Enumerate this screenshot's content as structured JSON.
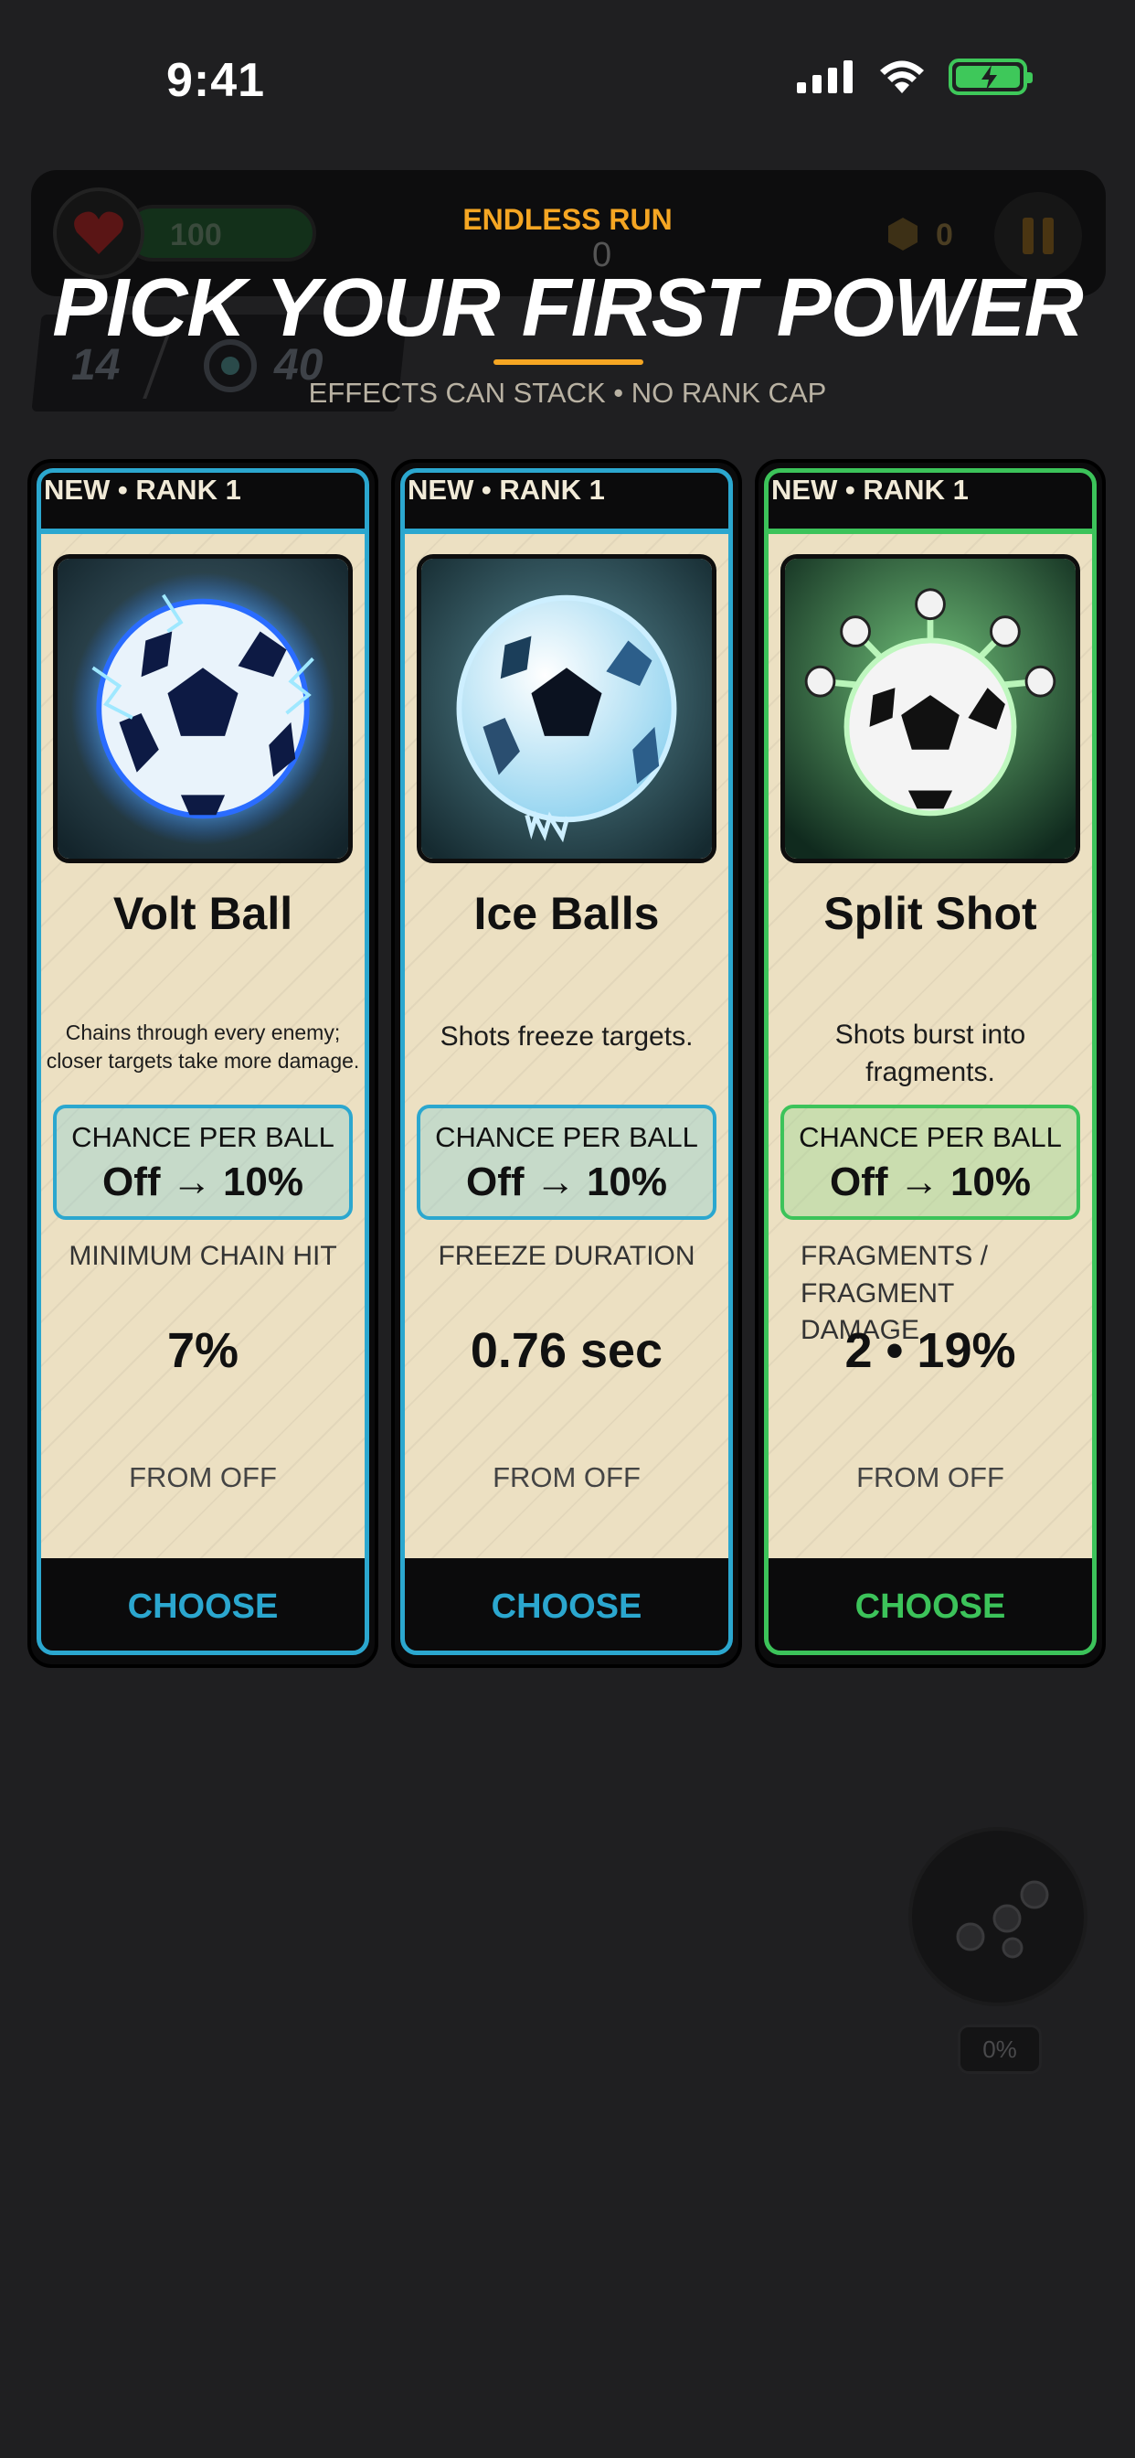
{
  "status_bar": {
    "time": "9:41"
  },
  "hud": {
    "hp": "100",
    "score": "0",
    "coins": "0",
    "stat_left": "14",
    "stat_right": "40"
  },
  "header": {
    "mode": "ENDLESS RUN",
    "title": "PICK YOUR FIRST POWER",
    "subtitle": "EFFECTS CAN STACK • NO RANK CAP"
  },
  "cards": [
    {
      "tag": "NEW • RANK 1",
      "name": "Volt Ball",
      "description": "Chains through every enemy; closer targets take more damage.",
      "chance_label": "CHANCE PER BALL",
      "chance_value": "Off → 10%",
      "stat_label": "MINIMUM CHAIN HIT",
      "stat_value": "7%",
      "stat_from": "FROM OFF",
      "button": "CHOOSE",
      "accent": "#2ba7cf"
    },
    {
      "tag": "NEW • RANK 1",
      "name": "Ice Balls",
      "description": "Shots freeze targets.",
      "chance_label": "CHANCE PER BALL",
      "chance_value": "Off → 10%",
      "stat_label": "FREEZE DURATION",
      "stat_value": "0.76 sec",
      "stat_from": "FROM OFF",
      "button": "CHOOSE",
      "accent": "#2ba7cf"
    },
    {
      "tag": "NEW • RANK 1",
      "name": "Split Shot",
      "description": "Shots burst into fragments.",
      "chance_label": "CHANCE PER BALL",
      "chance_value": "Off → 10%",
      "stat_label": "FRAGMENTS / FRAGMENT DAMAGE",
      "stat_value": "2 • 19%",
      "stat_from": "FROM OFF",
      "button": "CHOOSE",
      "accent": "#3cc35a"
    }
  ],
  "auto_button": {
    "progress_text": "0%"
  }
}
